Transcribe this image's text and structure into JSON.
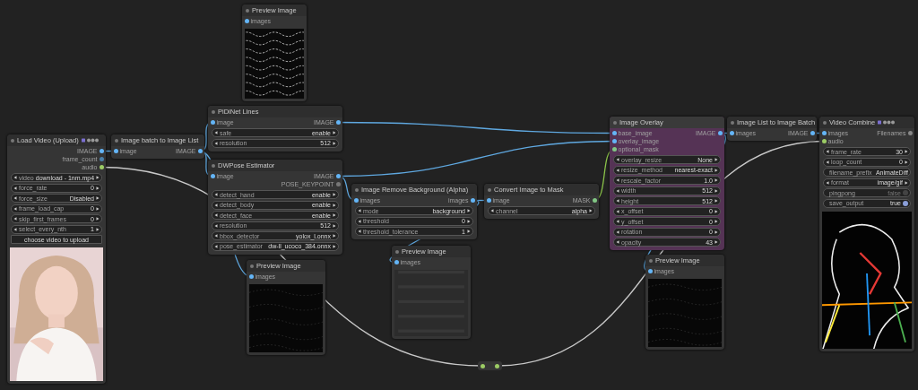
{
  "nodes": [
    {
      "kind": "preview",
      "title": "Preview Image",
      "inputs": [
        {
          "label": "images",
          "color": "#64b5f6"
        }
      ],
      "preview": {
        "kind": "picture"
      }
    },
    {
      "kind": "node",
      "title": "PiDiNet Lines",
      "inputs": [
        {
          "label": "image",
          "color": "#64b5f6"
        }
      ],
      "outputs": [
        {
          "label": "IMAGE",
          "color": "#64b5f6"
        }
      ],
      "widgets": [
        {
          "kind": "combo",
          "label": "safe",
          "value": "enable"
        },
        {
          "kind": "combo",
          "label": "resolution",
          "value": "512"
        }
      ]
    },
    {
      "kind": "preview",
      "title": "Load Video (Upload)",
      "badges": true,
      "outputs": [
        {
          "label": "IMAGE",
          "color": "#64b5f6"
        },
        {
          "label": "frame_count",
          "color": "#4a7fa8"
        },
        {
          "label": "audio",
          "color": "#9ccc65"
        }
      ],
      "widgets": [
        {
          "kind": "combo",
          "label": "video",
          "value": "download - 1nm.mp4"
        },
        {
          "kind": "combo",
          "label": "force_rate",
          "value": "0"
        },
        {
          "kind": "combo",
          "label": "force_size",
          "value": "Disabled"
        },
        {
          "kind": "combo",
          "label": "frame_load_cap",
          "value": "0"
        },
        {
          "kind": "combo",
          "label": "skip_first_frames",
          "value": "0"
        },
        {
          "kind": "combo",
          "label": "select_every_nth",
          "value": "1"
        },
        {
          "kind": "button",
          "label": "choose video to upload"
        }
      ],
      "preview": {
        "kind": "picture"
      }
    },
    {
      "kind": "node",
      "title": "Image batch to Image List",
      "inputs": [
        {
          "label": "image",
          "color": "#64b5f6"
        }
      ],
      "outputs": [
        {
          "label": "IMAGE",
          "color": "#64b5f6"
        }
      ]
    },
    {
      "kind": "node",
      "title": "DWPose Estimator",
      "inputs": [
        {
          "label": "image",
          "color": "#64b5f6"
        }
      ],
      "outputs": [
        {
          "label": "IMAGE",
          "color": "#64b5f6"
        },
        {
          "label": "POSE_KEYPOINT",
          "color": "#777777"
        }
      ],
      "widgets": [
        {
          "kind": "combo",
          "label": "detect_hand",
          "value": "enable"
        },
        {
          "kind": "combo",
          "label": "detect_body",
          "value": "enable"
        },
        {
          "kind": "combo",
          "label": "detect_face",
          "value": "enable"
        },
        {
          "kind": "combo",
          "label": "resolution",
          "value": "512"
        },
        {
          "kind": "combo",
          "label": "bbox_detector",
          "value": "yolox_l.onnx"
        },
        {
          "kind": "combo",
          "label": "pose_estimator",
          "value": "dw-ll_ucoco_384.onnx"
        }
      ]
    },
    {
      "kind": "preview",
      "title": "Preview Image",
      "inputs": [
        {
          "label": "images",
          "color": "#64b5f6"
        }
      ],
      "preview": {
        "kind": "picture"
      }
    },
    {
      "kind": "node",
      "title": "Image Remove Background (Alpha)",
      "inputs": [
        {
          "label": "images",
          "color": "#64b5f6"
        }
      ],
      "outputs": [
        {
          "label": "images",
          "color": "#64b5f6"
        }
      ],
      "widgets": [
        {
          "kind": "combo",
          "label": "mode",
          "value": "background"
        },
        {
          "kind": "combo",
          "label": "threshold",
          "value": "0"
        },
        {
          "kind": "combo",
          "label": "threshold_tolerance",
          "value": "1"
        }
      ]
    },
    {
      "kind": "node",
      "title": "Convert Image to Mask",
      "inputs": [
        {
          "label": "image",
          "color": "#64b5f6"
        }
      ],
      "outputs": [
        {
          "label": "MASK",
          "color": "#81c784"
        }
      ],
      "widgets": [
        {
          "kind": "combo",
          "label": "channel",
          "value": "alpha"
        }
      ]
    },
    {
      "kind": "preview",
      "title": "Preview Image",
      "inputs": [
        {
          "label": "images",
          "color": "#64b5f6"
        }
      ],
      "preview": {
        "kind": "picture"
      }
    },
    {
      "kind": "node",
      "title": "Image Overlay",
      "color": "#553355",
      "inputs": [
        {
          "label": "base_image",
          "color": "#64b5f6"
        },
        {
          "label": "overlay_image",
          "color": "#64b5f6"
        },
        {
          "label": "optional_mask",
          "color": "#81c784"
        }
      ],
      "outputs": [
        {
          "label": "IMAGE",
          "color": "#64b5f6"
        }
      ],
      "widgets": [
        {
          "kind": "combo",
          "label": "overlay_resize",
          "value": "None"
        },
        {
          "kind": "combo",
          "label": "resize_method",
          "value": "nearest-exact"
        },
        {
          "kind": "combo",
          "label": "rescale_factor",
          "value": "1.0"
        },
        {
          "kind": "combo",
          "label": "width",
          "value": "512"
        },
        {
          "kind": "combo",
          "label": "height",
          "value": "512"
        },
        {
          "kind": "combo",
          "label": "x_offset",
          "value": "0"
        },
        {
          "kind": "combo",
          "label": "y_offset",
          "value": "0"
        },
        {
          "kind": "combo",
          "label": "rotation",
          "value": "0"
        },
        {
          "kind": "combo",
          "label": "opacity",
          "value": "43"
        }
      ]
    },
    {
      "kind": "preview",
      "title": "Preview Image",
      "inputs": [
        {
          "label": "images",
          "color": "#64b5f6"
        }
      ],
      "preview": {
        "kind": "picture"
      }
    },
    {
      "kind": "node",
      "title": "Image List to Image Batch",
      "inputs": [
        {
          "label": "images",
          "color": "#64b5f6"
        }
      ],
      "outputs": [
        {
          "label": "IMAGE",
          "color": "#64b5f6"
        }
      ]
    },
    {
      "kind": "preview",
      "title": "Video Combine",
      "badges": true,
      "inputs": [
        {
          "label": "images",
          "color": "#64b5f6"
        },
        {
          "label": "audio",
          "color": "#9ccc65"
        }
      ],
      "outputs": [
        {
          "label": "Filenames",
          "color": "#888888"
        }
      ],
      "widgets": [
        {
          "kind": "combo",
          "label": "frame_rate",
          "value": "30"
        },
        {
          "kind": "combo",
          "label": "loop_count",
          "value": "0"
        },
        {
          "kind": "text",
          "label": "filename_prefix",
          "value": "AnimateDiff"
        },
        {
          "kind": "combo",
          "label": "format",
          "value": "image/gif"
        },
        {
          "kind": "toggle",
          "label": "pingpong",
          "value": "false",
          "on": false
        },
        {
          "kind": "toggle",
          "label": "save_output",
          "value": "true",
          "on": true
        }
      ],
      "preview": {
        "kind": "picture"
      }
    },
    {
      "kind": "reroute",
      "inputs": [
        {
          "color": "#9ccc65"
        }
      ],
      "outputs": [
        {
          "color": "#9ccc65"
        }
      ]
    }
  ]
}
